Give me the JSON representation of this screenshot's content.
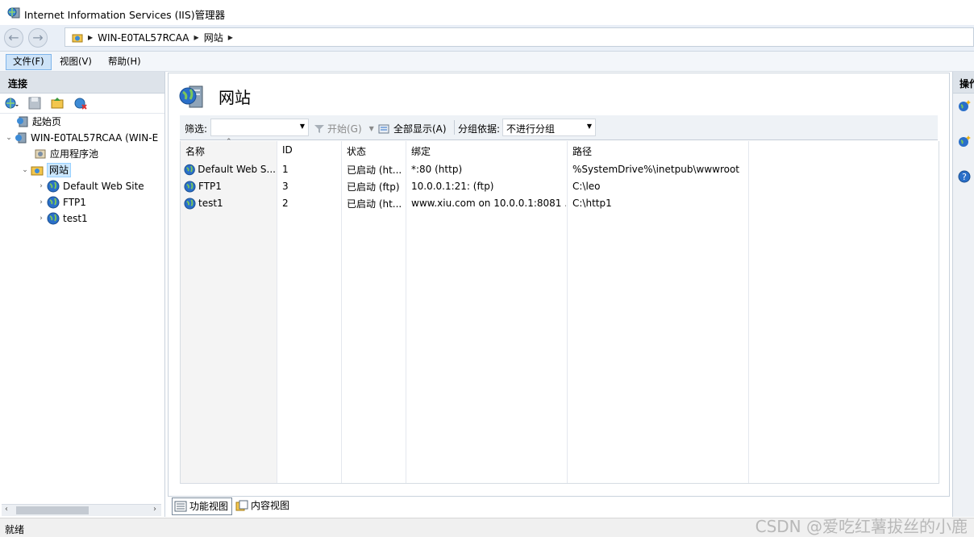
{
  "window": {
    "title": "Internet Information Services (IIS)管理器"
  },
  "address": {
    "crumbs": [
      "WIN-E0TAL57RCAA",
      "网站"
    ]
  },
  "menu": {
    "items": [
      "文件(F)",
      "视图(V)",
      "帮助(H)"
    ]
  },
  "connections": {
    "title": "连接",
    "tree": {
      "start_page": "起始页",
      "server": "WIN-E0TAL57RCAA (WIN-E",
      "app_pools": "应用程序池",
      "sites": "网站",
      "site_nodes": [
        "Default Web Site",
        "FTP1",
        "test1"
      ]
    }
  },
  "page": {
    "title": "网站",
    "filter": {
      "label": "筛选:",
      "value": "",
      "start_label": "开始(G)",
      "show_all_label": "全部显示(A)",
      "group_by_label": "分组依据:",
      "group_by_value": "不进行分组"
    },
    "columns": [
      "名称",
      "ID",
      "状态",
      "绑定",
      "路径"
    ],
    "rows": [
      {
        "name": "Default Web S...",
        "id": "1",
        "status": "已启动 (ht...",
        "binding": "*:80 (http)",
        "path": "%SystemDrive%\\inetpub\\wwwroot"
      },
      {
        "name": "FTP1",
        "id": "3",
        "status": "已启动 (ftp)",
        "binding": "10.0.0.1:21: (ftp)",
        "path": "C:\\leo"
      },
      {
        "name": "test1",
        "id": "2",
        "status": "已启动 (ht...",
        "binding": "www.xiu.com on 10.0.0.1:8081 ...",
        "path": "C:\\http1"
      }
    ],
    "view_tabs": [
      "功能视图",
      "内容视图"
    ]
  },
  "actions": {
    "title": "操作"
  },
  "status": {
    "text": "就绪"
  },
  "watermark": {
    "text": "CSDN @爱吃红薯拔丝的小鹿"
  },
  "icons": {
    "app": "iis-server-icon",
    "back": "back-arrow-icon",
    "forward": "forward-arrow-icon",
    "globe": "globe-icon",
    "folder": "sites-folder-icon",
    "save": "save-icon",
    "help": "help-icon",
    "filter": "filter-icon"
  },
  "colors": {
    "selection": "#cce8ff",
    "accent": "#2a6fc9",
    "panel_header": "#dde3ea"
  }
}
